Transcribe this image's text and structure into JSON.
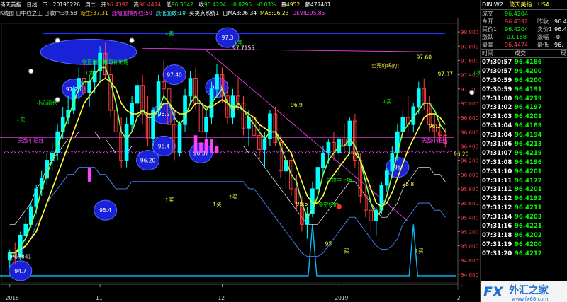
{
  "header": {
    "symbol": "倚天美指",
    "period": "日线",
    "direction": "下",
    "date": "20190226",
    "weekday": "周二",
    "open_label": "开",
    "open": "96.4392",
    "high_label": "高",
    "high": "96.4474",
    "low_label": "低",
    "low": "96.3542",
    "close_label": "收",
    "close": "96.4204",
    "change": "-0.0295",
    "change_pct": "-0.03%",
    "vol_label": "量",
    "vol": "4952",
    "amount_label": "额",
    "amount": "477401"
  },
  "indicators": [
    {
      "text": "K线图 日中线之王 日散户:39.58",
      "color": "#e0e0e0"
    },
    {
      "text": "新生:37.31",
      "color": "#ffd700"
    },
    {
      "text": "涨幅面横界线:50",
      "color": "#ff40ff"
    },
    {
      "text": "涨低面敢:10",
      "color": "#40ffff"
    },
    {
      "text": "买卖点系统1",
      "color": "#ffffff"
    },
    {
      "text": "日MA3:96.34",
      "color": "#ffffff"
    },
    {
      "text": "MA8:96.23",
      "color": "#ffff40"
    },
    {
      "text": "DEVIL:95.85",
      "color": "#ff40ff"
    }
  ],
  "quote": {
    "code": "DINIW2",
    "name": "倚天美指",
    "market": "USA",
    "rows": [
      {
        "l1": "成交",
        "v1": "96.4204",
        "l2": "",
        "v2": "",
        "c1": "#00ff00"
      },
      {
        "l1": "今开",
        "v1": "96.4392",
        "l2": "昨收",
        "v2": "96.4",
        "c1": "#ff4040"
      },
      {
        "l1": "买价1",
        "v1": "96.4204",
        "l2": "卖价1",
        "v2": "96.4",
        "c1": "#00ff00"
      },
      {
        "l1": "涨跌",
        "v1": "-0.0188",
        "l2": "涨幅",
        "v2": "-0.",
        "c1": "#00ff00"
      },
      {
        "l1": "最高",
        "v1": "96.4474",
        "l2": "最低",
        "v2": "96.",
        "c1": "#ff4040"
      }
    ],
    "tick_header": {
      "time": "时间",
      "price": "成交",
      "vol": "现"
    },
    "ticks": [
      {
        "time": "07:30:57",
        "price": "96.4186"
      },
      {
        "time": "07:30:57",
        "price": "96.4200"
      },
      {
        "time": "07:30:59",
        "price": "96.4200"
      },
      {
        "time": "07:30:59",
        "price": "96.4191"
      },
      {
        "time": "07:31:00",
        "price": "96.4219"
      },
      {
        "time": "07:31:02",
        "price": "96.4197"
      },
      {
        "time": "07:31:03",
        "price": "96.4201"
      },
      {
        "time": "07:31:04",
        "price": "96.4189"
      },
      {
        "time": "07:31:04",
        "price": "96.4194"
      },
      {
        "time": "07:31:06",
        "price": "96.4213"
      },
      {
        "time": "07:31:07",
        "price": "96.4219"
      },
      {
        "time": "07:31:08",
        "price": "96.4196"
      },
      {
        "time": "07:31:10",
        "price": "96.4201"
      },
      {
        "time": "07:31:11",
        "price": "96.4172"
      },
      {
        "time": "07:31:11",
        "price": "96.4201"
      },
      {
        "time": "07:31:12",
        "price": "96.4192"
      },
      {
        "time": "07:31:12",
        "price": "96.4211"
      },
      {
        "time": "07:31:14",
        "price": "96.4203"
      },
      {
        "time": "07:31:16",
        "price": "96.4221"
      },
      {
        "time": "07:31:18",
        "price": "96.4202"
      },
      {
        "time": "07:31:19",
        "price": "96.4200"
      },
      {
        "time": "07:31:20",
        "price": "96.4212"
      }
    ],
    "watermark": "外汇之家",
    "watermark_brand": "FX",
    "watermark_url": "www.fx68.com"
  },
  "chart_data": {
    "type": "candlestick",
    "ylim": [
      94.5,
      98.1
    ],
    "yticks": [
      "98.000",
      "97.800",
      "97.600",
      "97.400",
      "97.200",
      "97.000",
      "96.800",
      "96.600",
      "96.400",
      "96.200",
      "96.000",
      "95.800",
      "95.600",
      "95.400",
      "95.200",
      "95.000",
      "94.800",
      "94.600"
    ],
    "xlabels": [
      {
        "label": "2018",
        "index": 0
      },
      {
        "label": "11",
        "index": 17
      },
      {
        "label": "12",
        "index": 40
      },
      {
        "label": "2019",
        "index": 62
      },
      {
        "label": "2",
        "index": 85
      }
    ],
    "up_color": "#00ffff",
    "down_color": "#ff4040",
    "candles": [
      [
        94.8,
        94.95,
        94.7,
        94.9
      ],
      [
        94.9,
        95.05,
        94.75,
        94.85
      ],
      [
        94.85,
        95.2,
        94.8,
        95.15
      ],
      [
        95.15,
        95.4,
        95.05,
        95.3
      ],
      [
        95.3,
        95.6,
        95.25,
        95.55
      ],
      [
        95.55,
        95.85,
        95.45,
        95.8
      ],
      [
        95.8,
        96.05,
        95.7,
        95.95
      ],
      [
        95.95,
        96.3,
        95.85,
        96.2
      ],
      [
        96.2,
        96.45,
        96.05,
        96.3
      ],
      [
        96.3,
        96.7,
        96.2,
        96.6
      ],
      [
        96.6,
        96.95,
        96.5,
        96.8
      ],
      [
        96.8,
        97.1,
        96.7,
        96.9
      ],
      [
        96.9,
        97.25,
        96.85,
        97.2
      ],
      [
        97.2,
        97.5,
        97.05,
        97.35
      ],
      [
        97.35,
        97.55,
        97.1,
        97.15
      ],
      [
        97.15,
        97.4,
        96.95,
        97.3
      ],
      [
        97.3,
        97.6,
        97.15,
        97.45
      ],
      [
        97.45,
        97.8,
        97.3,
        97.7
      ],
      [
        97.7,
        97.85,
        97.35,
        97.4
      ],
      [
        97.4,
        97.55,
        96.8,
        96.9
      ],
      [
        96.9,
        97.2,
        96.5,
        96.6
      ],
      [
        96.6,
        96.8,
        96.1,
        96.2
      ],
      [
        96.2,
        96.8,
        96.1,
        96.7
      ],
      [
        96.7,
        97.1,
        96.6,
        97.0
      ],
      [
        97.0,
        97.35,
        96.85,
        97.25
      ],
      [
        97.25,
        97.4,
        96.7,
        96.85
      ],
      [
        96.85,
        97.1,
        96.4,
        96.5
      ],
      [
        96.5,
        96.95,
        96.4,
        96.9
      ],
      [
        96.9,
        97.4,
        96.8,
        97.3
      ],
      [
        97.3,
        97.6,
        97.1,
        97.2
      ],
      [
        97.2,
        97.3,
        96.6,
        96.7
      ],
      [
        96.7,
        96.9,
        96.2,
        96.3
      ],
      [
        96.3,
        96.75,
        96.25,
        96.7
      ],
      [
        96.7,
        97.2,
        96.6,
        97.1
      ],
      [
        97.1,
        97.45,
        97.0,
        97.35
      ],
      [
        97.35,
        97.5,
        96.9,
        97.0
      ],
      [
        97.0,
        97.15,
        96.55,
        96.6
      ],
      [
        96.6,
        96.9,
        96.35,
        96.8
      ],
      [
        96.8,
        97.3,
        96.7,
        97.2
      ],
      [
        97.2,
        97.55,
        97.1,
        97.4
      ],
      [
        97.4,
        97.5,
        97.0,
        97.1
      ],
      [
        97.1,
        97.3,
        96.7,
        96.8
      ],
      [
        96.8,
        97.2,
        96.7,
        97.1
      ],
      [
        97.1,
        97.35,
        96.9,
        97.0
      ],
      [
        97.0,
        97.1,
        96.55,
        96.65
      ],
      [
        96.65,
        96.9,
        96.4,
        96.8
      ],
      [
        96.8,
        96.95,
        96.45,
        96.55
      ],
      [
        96.55,
        96.7,
        96.2,
        96.35
      ],
      [
        96.35,
        96.6,
        96.1,
        96.5
      ],
      [
        96.5,
        96.9,
        96.4,
        96.85
      ],
      [
        96.85,
        96.95,
        96.4,
        96.45
      ],
      [
        96.45,
        96.55,
        95.95,
        96.05
      ],
      [
        96.05,
        96.3,
        95.8,
        96.2
      ],
      [
        96.2,
        96.3,
        95.7,
        95.8
      ],
      [
        95.8,
        96.0,
        95.5,
        95.6
      ],
      [
        95.6,
        95.7,
        95.2,
        95.3
      ],
      [
        95.3,
        95.55,
        95.1,
        95.45
      ],
      [
        95.45,
        95.9,
        95.4,
        95.8
      ],
      [
        95.8,
        96.2,
        95.7,
        96.1
      ],
      [
        96.1,
        96.4,
        96.0,
        96.3
      ],
      [
        96.3,
        96.5,
        96.15,
        96.45
      ],
      [
        96.45,
        96.6,
        96.2,
        96.3
      ],
      [
        96.3,
        96.55,
        96.0,
        96.5
      ],
      [
        96.5,
        96.7,
        96.3,
        96.4
      ],
      [
        96.4,
        96.8,
        96.3,
        96.75
      ],
      [
        96.75,
        96.85,
        96.1,
        96.2
      ],
      [
        96.2,
        96.3,
        95.6,
        95.7
      ],
      [
        95.7,
        95.85,
        95.4,
        95.5
      ],
      [
        95.5,
        95.6,
        95.2,
        95.35
      ],
      [
        95.35,
        95.55,
        95.15,
        95.5
      ],
      [
        95.5,
        95.9,
        95.45,
        95.85
      ],
      [
        95.85,
        96.1,
        95.75,
        96.05
      ],
      [
        96.05,
        96.4,
        95.95,
        96.3
      ],
      [
        96.3,
        96.7,
        96.2,
        96.6
      ],
      [
        96.6,
        96.9,
        96.5,
        96.8
      ],
      [
        96.8,
        97.1,
        96.6,
        96.7
      ],
      [
        96.7,
        97.0,
        96.6,
        96.95
      ],
      [
        96.95,
        97.3,
        96.85,
        97.2
      ],
      [
        97.2,
        97.35,
        96.9,
        97.0
      ],
      [
        97.0,
        97.1,
        96.6,
        96.7
      ],
      [
        96.7,
        96.85,
        96.45,
        96.6
      ],
      [
        96.6,
        96.75,
        96.45,
        96.55
      ],
      [
        96.55,
        96.65,
        96.38,
        96.44
      ]
    ],
    "ma_fast": [
      94.9,
      94.9,
      95.0,
      95.1,
      95.3,
      95.5,
      95.8,
      96.0,
      96.2,
      96.4,
      96.6,
      96.8,
      97.0,
      97.2,
      97.3,
      97.3,
      97.4,
      97.5,
      97.5,
      97.3,
      97.0,
      96.6,
      96.5,
      96.6,
      96.8,
      96.9,
      96.8,
      96.8,
      96.9,
      97.1,
      97.0,
      96.8,
      96.7,
      96.8,
      97.0,
      97.1,
      97.0,
      96.9,
      97.0,
      97.1,
      97.2,
      97.0,
      96.9,
      97.0,
      96.9,
      96.8,
      96.7,
      96.6,
      96.5,
      96.6,
      96.6,
      96.4,
      96.2,
      96.0,
      95.9,
      95.6,
      95.4,
      95.5,
      95.7,
      96.0,
      96.2,
      96.3,
      96.4,
      96.4,
      96.5,
      96.4,
      96.2,
      95.9,
      95.6,
      95.4,
      95.5,
      95.7,
      96.0,
      96.3,
      96.6,
      96.7,
      96.8,
      96.9,
      97.0,
      97.0,
      96.9,
      96.7,
      96.6
    ],
    "ma_slow": [
      94.9,
      94.9,
      94.95,
      95.0,
      95.1,
      95.2,
      95.4,
      95.6,
      95.8,
      96.0,
      96.2,
      96.4,
      96.6,
      96.8,
      97.0,
      97.1,
      97.2,
      97.3,
      97.35,
      97.3,
      97.2,
      97.0,
      96.9,
      96.85,
      96.85,
      96.9,
      96.85,
      96.85,
      96.9,
      97.0,
      97.0,
      96.9,
      96.85,
      96.85,
      96.9,
      97.0,
      97.0,
      96.95,
      96.95,
      97.0,
      97.05,
      97.0,
      96.95,
      96.95,
      96.9,
      96.85,
      96.8,
      96.7,
      96.65,
      96.6,
      96.6,
      96.5,
      96.4,
      96.3,
      96.1,
      95.9,
      95.7,
      95.6,
      95.6,
      95.7,
      95.9,
      96.0,
      96.1,
      96.2,
      96.3,
      96.3,
      96.2,
      96.0,
      95.8,
      95.6,
      95.55,
      95.6,
      95.75,
      95.95,
      96.15,
      96.35,
      96.5,
      96.65,
      96.8,
      96.85,
      96.85,
      96.8,
      96.7
    ],
    "band_upper": [
      95.3,
      95.3,
      95.4,
      95.5,
      95.6,
      95.8,
      95.9,
      96.1,
      96.2,
      96.3,
      96.4,
      96.5,
      96.5,
      96.6,
      96.6,
      96.6,
      96.6,
      96.5,
      96.5,
      96.4,
      96.3,
      96.3,
      96.3,
      96.4,
      96.4,
      96.4,
      96.4,
      96.4,
      96.4,
      96.4,
      96.4,
      96.4,
      96.4,
      96.4,
      96.4,
      96.4,
      96.4,
      96.4,
      96.4,
      96.4,
      96.4,
      96.4,
      96.4,
      96.4,
      96.4,
      96.3,
      96.3,
      96.2,
      96.1,
      96.0,
      95.9,
      95.8,
      95.7,
      95.6,
      95.5,
      95.4,
      95.3,
      95.3,
      95.3,
      95.4,
      95.5,
      95.6,
      95.7,
      95.8,
      95.9,
      95.9,
      95.8,
      95.7,
      95.6,
      95.5,
      95.4,
      95.4,
      95.5,
      95.6,
      95.8,
      95.9,
      96.0,
      96.1,
      96.1,
      96.1,
      96.0,
      96.0,
      95.9
    ],
    "band_lower": [
      94.8,
      94.8,
      94.9,
      95.0,
      95.1,
      95.3,
      95.4,
      95.6,
      95.7,
      95.8,
      95.9,
      96.0,
      96.0,
      96.1,
      96.1,
      96.1,
      96.1,
      96.0,
      96.0,
      95.9,
      95.8,
      95.8,
      95.8,
      95.9,
      95.9,
      95.9,
      95.9,
      95.9,
      95.9,
      95.9,
      95.9,
      95.9,
      95.9,
      95.9,
      95.9,
      95.9,
      95.9,
      95.9,
      95.9,
      95.9,
      95.9,
      95.9,
      95.9,
      95.9,
      95.9,
      95.8,
      95.8,
      95.7,
      95.6,
      95.5,
      95.4,
      95.3,
      95.2,
      95.1,
      95.0,
      94.9,
      94.85,
      94.85,
      94.85,
      94.9,
      95.0,
      95.1,
      95.2,
      95.3,
      95.4,
      95.4,
      95.3,
      95.2,
      95.1,
      95.0,
      94.95,
      94.95,
      95.0,
      95.1,
      95.3,
      95.4,
      95.5,
      95.6,
      95.6,
      95.6,
      95.5,
      95.5,
      95.4
    ],
    "price_labels": [
      {
        "text": "94.7841",
        "i": 2,
        "y": 94.82,
        "color": "#ffffff"
      },
      {
        "text": "97.7155",
        "i": 44,
        "y": 97.75,
        "color": "#ffffff"
      },
      {
        "text": "97.60",
        "i": 78,
        "y": 97.62,
        "color": "#ffff40"
      },
      {
        "text": "97.37",
        "i": 82,
        "y": 97.38,
        "color": "#ffff40"
      },
      {
        "text": "96.9",
        "i": 54,
        "y": 96.95,
        "color": "#ffff40"
      },
      {
        "text": "96.2",
        "i": 80,
        "y": 96.65,
        "color": "#ffff40"
      },
      {
        "text": "96.20",
        "i": 85,
        "y": 96.26,
        "color": "#ffff40"
      },
      {
        "text": "95.8",
        "i": 75,
        "y": 95.84,
        "color": "#ffff40"
      },
      {
        "text": "95.6",
        "i": 55,
        "y": 95.56,
        "color": "#ffff40"
      },
      {
        "text": "95",
        "i": 60,
        "y": 95.0,
        "color": "#ffff40"
      }
    ],
    "annotations": [
      {
        "text": "空哥你别跑",
        "i": 16,
        "y": 97.55,
        "color": "#00ff00"
      },
      {
        "text": "空哥你别跑",
        "i": 20,
        "y": 97.55,
        "color": "#00ff00"
      },
      {
        "text": "小心清仓",
        "i": 7,
        "y": 96.98,
        "color": "#00ff00"
      },
      {
        "text": "无敌中阳线",
        "i": 4,
        "y": 96.45,
        "color": "#ff40ff"
      },
      {
        "text": "无敌中阳线",
        "i": 80,
        "y": 96.45,
        "color": "#ff40ff"
      },
      {
        "text": "空死你吗的！",
        "i": 71,
        "y": 97.5,
        "color": "#ffff40"
      },
      {
        "text": "抗撞中上场",
        "i": 62,
        "y": 95.9,
        "color": "#00ff00"
      },
      {
        "text": "多空好的",
        "i": 60,
        "y": 95.55,
        "color": "#00ff00"
      },
      {
        "text": "↓卖",
        "i": 2,
        "y": 96.75,
        "color": "#00ff00"
      },
      {
        "text": "↓卖",
        "i": 15,
        "y": 97.4,
        "color": "#00ff00"
      },
      {
        "text": "↓卖",
        "i": 30,
        "y": 97.95,
        "color": "#00ff00"
      },
      {
        "text": "↓卖",
        "i": 43,
        "y": 97.82,
        "color": "#00ff00"
      },
      {
        "text": "↓卖",
        "i": 71,
        "y": 97.0,
        "color": "#00ff00"
      },
      {
        "text": "↓卖",
        "i": 88,
        "y": 97.4,
        "color": "#00ff00"
      },
      {
        "text": "↑买",
        "i": 30,
        "y": 95.62,
        "color": "#ffff40"
      },
      {
        "text": "↑买",
        "i": 39,
        "y": 95.56,
        "color": "#ffff40"
      },
      {
        "text": "↑买",
        "i": 42,
        "y": 95.66,
        "color": "#ffff40"
      },
      {
        "text": "↑买",
        "i": 63,
        "y": 94.9,
        "color": "#ffff40"
      },
      {
        "text": "↑买",
        "i": 77,
        "y": 94.9,
        "color": "#ffff40"
      }
    ],
    "circled_labels": [
      {
        "text": "97.20",
        "i": 12,
        "y": 97.2
      },
      {
        "text": "97.40",
        "i": 31,
        "y": 97.4
      },
      {
        "text": "96.9",
        "i": 29,
        "y": 96.85
      },
      {
        "text": "97.3",
        "i": 39,
        "y": 97.22
      },
      {
        "text": "96.4",
        "i": 29,
        "y": 96.4
      },
      {
        "text": "96.37",
        "i": 36,
        "y": 96.3
      },
      {
        "text": "96.20",
        "i": 26,
        "y": 96.2
      },
      {
        "text": "95.4",
        "i": 18,
        "y": 95.5
      },
      {
        "text": "97.3",
        "i": 41,
        "y": 97.92
      },
      {
        "text": "95",
        "i": 73,
        "y": 96.1
      },
      {
        "text": "94.7",
        "i": 2,
        "y": 94.65
      }
    ]
  }
}
